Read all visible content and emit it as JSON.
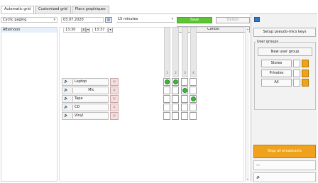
{
  "tabs": [
    {
      "label": "Automatic grid"
    },
    {
      "label": "Customized grid"
    },
    {
      "label": "Plans graphiques"
    }
  ],
  "toolbar": {
    "mode_value": "Cyclic paging",
    "date_value": "03.07.2020",
    "interval_value": "15 minutes",
    "save_label": "Save",
    "delete_label": "Delete",
    "cancel_label": "Cancel",
    "time_from": "13:30",
    "time_to": "13:37"
  },
  "left": {
    "selected_item": "Afternoon"
  },
  "grid": {
    "columns": [
      "1",
      "2",
      "3",
      "4"
    ],
    "rows": [
      {
        "label": "Laptop"
      },
      {
        "label": "Mic"
      },
      {
        "label": "Tape"
      },
      {
        "label": "CD"
      },
      {
        "label": "Vinyl"
      }
    ]
  },
  "right": {
    "setup_label": "Setup pseudo-mics keys",
    "group_title": "User groups",
    "new_group_label": "New user group",
    "groups": [
      {
        "name": "Stores"
      },
      {
        "name": "Privates"
      },
      {
        "name": "All"
      }
    ],
    "stop_label": "Stop all broadcasts"
  },
  "icons": {
    "speaker": "speaker-icon",
    "mic": "mic-icon",
    "calendar": "calendar-icon",
    "pencil": "pencil-icon",
    "trash": "trash-icon",
    "close": "close-icon"
  },
  "colors": {
    "save": "#5cc530",
    "on_dot": "#3fb43f",
    "orange": "#f0a21c",
    "accent": "#2e78c8"
  }
}
